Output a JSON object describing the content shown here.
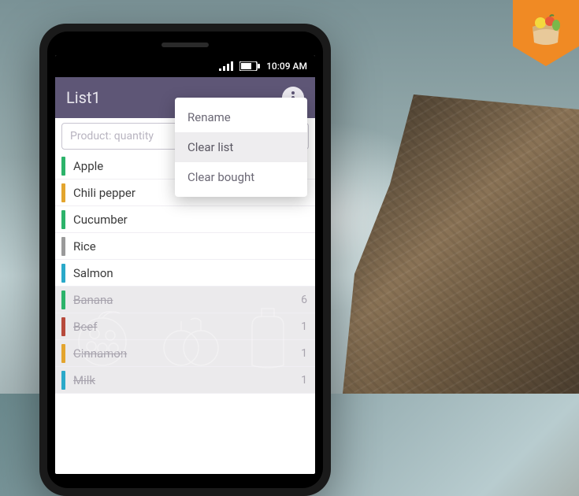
{
  "statusbar": {
    "time": "10:09 AM"
  },
  "header": {
    "title": "List1"
  },
  "input": {
    "placeholder": "Product: quantity"
  },
  "menu": {
    "items": [
      {
        "label": "Rename",
        "highlight": false
      },
      {
        "label": "Clear list",
        "highlight": true
      },
      {
        "label": "Clear bought",
        "highlight": false
      }
    ]
  },
  "list": {
    "active": [
      {
        "name": "Apple",
        "color": "#2cb36a"
      },
      {
        "name": "Chili pepper",
        "color": "#e3a52e"
      },
      {
        "name": "Cucumber",
        "color": "#2cb36a"
      },
      {
        "name": "Rice",
        "color": "#9a9a9a"
      },
      {
        "name": "Salmon",
        "color": "#2aa9c9"
      }
    ],
    "bought": [
      {
        "name": "Banana",
        "qty": "6",
        "color": "#2cb36a"
      },
      {
        "name": "Beef",
        "qty": "1",
        "color": "#b74a3c"
      },
      {
        "name": "Cinnamon",
        "qty": "1",
        "color": "#e3a52e"
      },
      {
        "name": "Milk",
        "qty": "1",
        "color": "#2aa9c9"
      }
    ]
  }
}
